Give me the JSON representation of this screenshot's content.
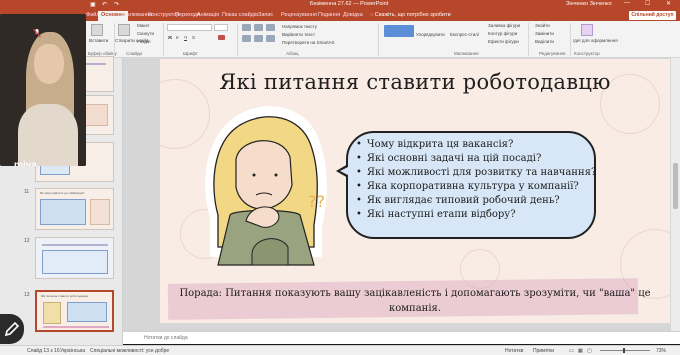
{
  "titlebar": {
    "doc_title": "Безіменна 27.62 — PowerPoint",
    "user": "Зінченко Зінченко",
    "minimize": "—",
    "maximize": "☐",
    "close": "✕"
  },
  "tabs": [
    "Файл",
    "Основне",
    "Малювання",
    "Конструктор",
    "Переходи",
    "Анімація",
    "Показ слайдів",
    "Запис",
    "Рецензування",
    "Подання",
    "Довідка"
  ],
  "tell_me": "Скажіть, що потрібно зробити",
  "share_label": "Спільний доступ",
  "ribbon": {
    "clipboard_group": "Буфер обміну",
    "slides_group": "Слайди",
    "font_group": "Шрифт",
    "paragraph_group": "Абзац",
    "drawing_group": "Малювання",
    "editing_group": "Редагування",
    "designer_group": "Конструктор",
    "paste": "Вставити",
    "new_slide": "Створити слайд",
    "layout": "Макет",
    "reset": "Скинути",
    "section": "Розділ",
    "arrange": "Упорядкувати",
    "quick_styles": "Експрес-стилі",
    "shape_fill": "Заливка фігури",
    "shape_outline": "Контур фігури",
    "shape_effects": "Ефекти фігури",
    "find": "Знайти",
    "replace": "Замінити",
    "select": "Виділити",
    "designer": "Ідеї для оформлення",
    "text_direction": "Напрямок тексту",
    "align_text": "Вирівняти текст",
    "smartart": "Перетворити на SmartArt"
  },
  "thumbnails": [
    {
      "num": ""
    },
    {
      "num": ""
    },
    {
      "num": ""
    },
    {
      "num": "11",
      "title": "Як підготуватися до співбесіди?"
    },
    {
      "num": "12"
    },
    {
      "num": "13",
      "title": "Які питання ставити роботодавцю"
    }
  ],
  "slide": {
    "title": "Які питання ставити роботодавцю",
    "questions": [
      "Чому відкрита ця вакансія?",
      "Які основні задачі на цій посаді?",
      "Які можливості для розвитку та навчання?",
      "Яка корпоративна культура у компанії?",
      "Як виглядає типовий робочий день?",
      "Які наступні етапи відбору?"
    ],
    "tip_line1": "Порада: Питання показують вашу зацікавленість і допомагають зрозуміти, чи \"ваша\" це",
    "tip_line2": "компанія.",
    "question_marks": "??"
  },
  "notes_placeholder": "Нотатки до слайда",
  "status": {
    "slide_counter": "Слайд 13 з 16",
    "language": "Українська",
    "accessibility": "Спеціальні можливості: усе добре",
    "notes_btn": "Нотатки",
    "comments_btn": "Примітки",
    "zoom": "73%"
  },
  "video": {
    "participant": "miya"
  },
  "colors": {
    "accent": "#b7472a",
    "bubble": "#d7e7f7",
    "slide_bg": "#f8ece4"
  }
}
